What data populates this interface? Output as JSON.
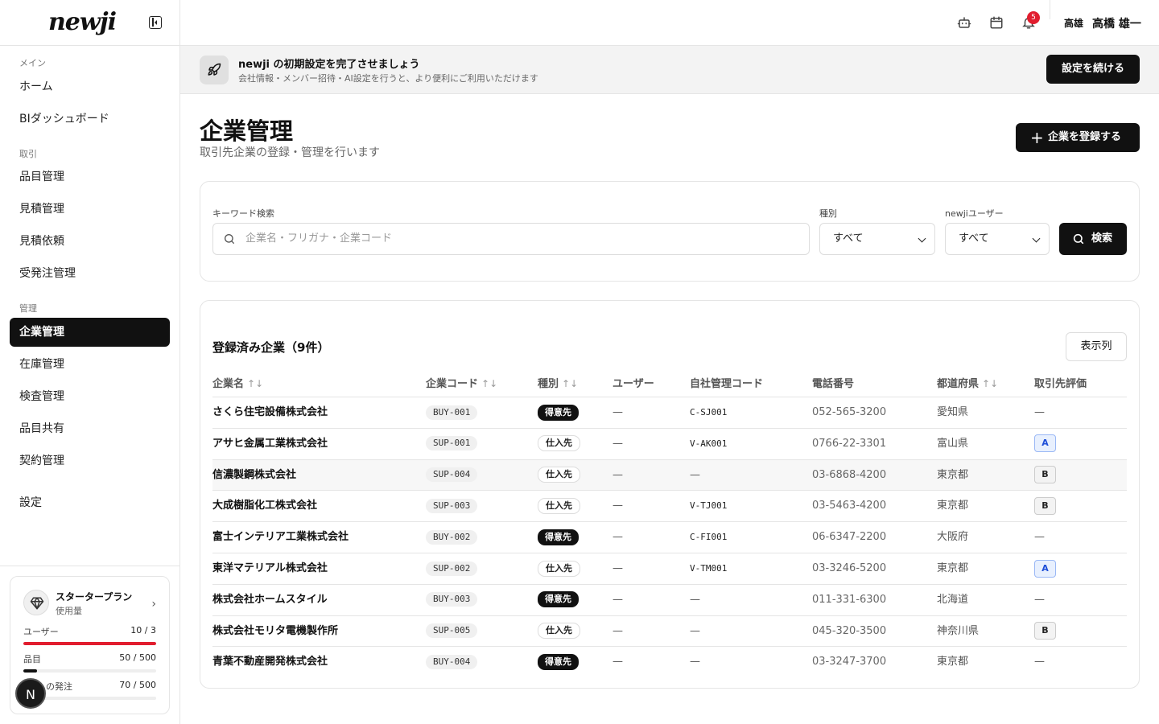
{
  "brand": {
    "logo": "newji"
  },
  "sidebar": {
    "sections": [
      {
        "label": "メイン"
      },
      {
        "label": "取引"
      },
      {
        "label": "管理"
      }
    ],
    "items": [
      {
        "label": "ホーム"
      },
      {
        "label": "BIダッシュボード"
      },
      {
        "label": "品目管理"
      },
      {
        "label": "見積管理"
      },
      {
        "label": "見積依頼"
      },
      {
        "label": "受発注管理"
      },
      {
        "label": "企業管理"
      },
      {
        "label": "在庫管理"
      },
      {
        "label": "検査管理"
      },
      {
        "label": "品目共有"
      },
      {
        "label": "契約管理"
      },
      {
        "label": "設定"
      }
    ],
    "active_item": "企業管理"
  },
  "plan": {
    "name": "スタータープラン",
    "sub": "使用量",
    "usage": [
      {
        "label": "ユーザー",
        "value": "10 / 3",
        "fraction": 1.0,
        "color": "#e11d2e"
      },
      {
        "label": "品目",
        "value": "50 / 500",
        "fraction": 0.1,
        "color": "#111111"
      },
      {
        "label": "の発注",
        "value": "70 / 500",
        "fraction": 0.14,
        "color": "#111111"
      }
    ],
    "avatar_letter": "N"
  },
  "topbar": {
    "icons": [
      "robot-icon",
      "calendar-icon",
      "bell-icon"
    ],
    "notification_count": "5",
    "user_short": "高雄",
    "user_full": "高橋 雄一"
  },
  "banner": {
    "title": "newji の初期設定を完了させましょう",
    "subtitle": "会社情報・メンバー招待・AI設定を行うと、より便利にご利用いただけます",
    "button": "設定を続ける"
  },
  "page": {
    "title": "企業管理",
    "subtitle": "取引先企業の登録・管理を行います",
    "add_button": "企業を登録する"
  },
  "search": {
    "keyword_label": "キーワード検索",
    "placeholder": "企業名・フリガナ・企業コード",
    "type_label": "種別",
    "type_value": "すべて",
    "user_label": "newjiユーザー",
    "user_value": "すべて",
    "button": "検索"
  },
  "table": {
    "title": "登録済み企業（9件）",
    "columns_button": "表示列",
    "headers": {
      "name": "企業名",
      "code": "企業コード",
      "type": "種別",
      "user": "ユーザー",
      "own_code": "自社管理コード",
      "phone": "電話番号",
      "pref": "都道府県",
      "rating": "取引先評価"
    },
    "sort_glyph": "↑↓",
    "rows": [
      {
        "name": "さくら住宅設備株式会社",
        "code": "BUY-001",
        "type": "得意先",
        "type_kind": "buy",
        "user": "—",
        "own_code": "C-SJ001",
        "phone": "052-565-3200",
        "pref": "愛知県",
        "rating": "—"
      },
      {
        "name": "アサヒ金属工業株式会社",
        "code": "SUP-001",
        "type": "仕入先",
        "type_kind": "sup",
        "user": "—",
        "own_code": "V-AK001",
        "phone": "0766-22-3301",
        "pref": "富山県",
        "rating": "A"
      },
      {
        "name": "信濃製鋼株式会社",
        "code": "SUP-004",
        "type": "仕入先",
        "type_kind": "sup",
        "user": "—",
        "own_code": "—",
        "phone": "03-6868-4200",
        "pref": "東京都",
        "rating": "B"
      },
      {
        "name": "大成樹脂化工株式会社",
        "code": "SUP-003",
        "type": "仕入先",
        "type_kind": "sup",
        "user": "—",
        "own_code": "V-TJ001",
        "phone": "03-5463-4200",
        "pref": "東京都",
        "rating": "B"
      },
      {
        "name": "富士インテリア工業株式会社",
        "code": "BUY-002",
        "type": "得意先",
        "type_kind": "buy",
        "user": "—",
        "own_code": "C-FI001",
        "phone": "06-6347-2200",
        "pref": "大阪府",
        "rating": "—"
      },
      {
        "name": "東洋マテリアル株式会社",
        "code": "SUP-002",
        "type": "仕入先",
        "type_kind": "sup",
        "user": "—",
        "own_code": "V-TM001",
        "phone": "03-3246-5200",
        "pref": "東京都",
        "rating": "A"
      },
      {
        "name": "株式会社ホームスタイル",
        "code": "BUY-003",
        "type": "得意先",
        "type_kind": "buy",
        "user": "—",
        "own_code": "—",
        "phone": "011-331-6300",
        "pref": "北海道",
        "rating": "—"
      },
      {
        "name": "株式会社モリタ電機製作所",
        "code": "SUP-005",
        "type": "仕入先",
        "type_kind": "sup",
        "user": "—",
        "own_code": "—",
        "phone": "045-320-3500",
        "pref": "神奈川県",
        "rating": "B"
      },
      {
        "name": "青葉不動産開発株式会社",
        "code": "BUY-004",
        "type": "得意先",
        "type_kind": "buy",
        "user": "—",
        "own_code": "—",
        "phone": "03-3247-3700",
        "pref": "東京都",
        "rating": "—"
      }
    ]
  }
}
